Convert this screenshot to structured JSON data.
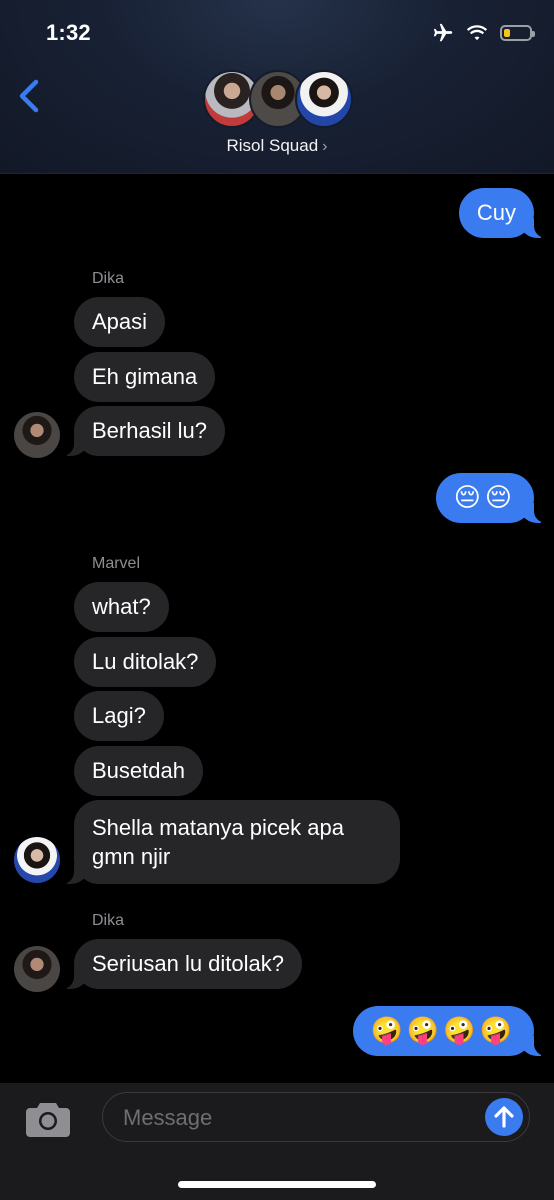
{
  "status_bar": {
    "time": "1:32"
  },
  "header": {
    "group_name": "Risol Squad",
    "chevron": "›"
  },
  "messages": [
    {
      "type": "out",
      "text": "Cuy"
    },
    {
      "type": "sender",
      "text": "Dika"
    },
    {
      "type": "in",
      "text": "Apasi"
    },
    {
      "type": "in",
      "text": "Eh gimana"
    },
    {
      "type": "in",
      "text": "Berhasil lu?"
    },
    {
      "type": "out",
      "text": "😔😔"
    },
    {
      "type": "sender",
      "text": "Marvel"
    },
    {
      "type": "in",
      "text": "what?"
    },
    {
      "type": "in",
      "text": "Lu ditolak?"
    },
    {
      "type": "in",
      "text": "Lagi?"
    },
    {
      "type": "in",
      "text": "Busetdah"
    },
    {
      "type": "in",
      "text": "Shella matanya picek apa gmn njir"
    },
    {
      "type": "sender",
      "text": "Dika"
    },
    {
      "type": "in",
      "text": "Seriusan lu ditolak?"
    },
    {
      "type": "out",
      "text": "🤪🤪🤪🤪"
    }
  ],
  "input": {
    "placeholder": "Message"
  },
  "icons": {
    "back": "chevron-left-icon",
    "airplane": "airplane-icon",
    "wifi": "wifi-icon",
    "battery": "battery-icon",
    "camera": "camera-icon",
    "send": "arrow-up-icon"
  },
  "colors": {
    "accent": "#3a7bf0",
    "incoming_bubble": "#262629",
    "battery": "#f5c518"
  }
}
